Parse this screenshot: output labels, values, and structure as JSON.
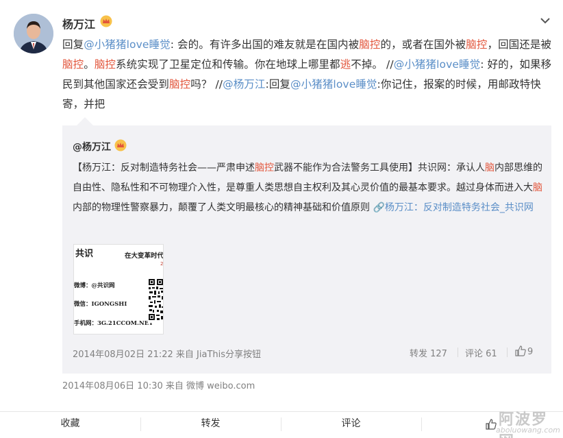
{
  "post": {
    "author": "杨万江",
    "segments": [
      {
        "t": "text",
        "v": "回复"
      },
      {
        "t": "mention",
        "v": "@小猪猪love睡觉"
      },
      {
        "t": "text",
        "v": ": 会的。有许多出国的难友就是在国内被"
      },
      {
        "t": "kw",
        "v": "脑控"
      },
      {
        "t": "text",
        "v": "的，或者在国外被"
      },
      {
        "t": "kw",
        "v": "脑控"
      },
      {
        "t": "text",
        "v": "，回国还是被"
      },
      {
        "t": "kw",
        "v": "脑控"
      },
      {
        "t": "text",
        "v": "。"
      },
      {
        "t": "kw",
        "v": "脑控"
      },
      {
        "t": "text",
        "v": "系统实现了卫星定位和传输。你在地球上哪里都"
      },
      {
        "t": "kw",
        "v": "逃"
      },
      {
        "t": "text",
        "v": "不掉。 //"
      },
      {
        "t": "mention",
        "v": "@小猪猪love睡觉"
      },
      {
        "t": "text",
        "v": ": 好的，如果移民到其他国家还会受到"
      },
      {
        "t": "kw",
        "v": "脑控"
      },
      {
        "t": "text",
        "v": "吗？ //"
      },
      {
        "t": "mention",
        "v": "@杨万江"
      },
      {
        "t": "text",
        "v": ":回复"
      },
      {
        "t": "mention",
        "v": "@小猪猪love睡觉"
      },
      {
        "t": "text",
        "v": ":你记住，报案的时候，用邮政特快寄，并把"
      }
    ],
    "meta": "2014年08月06日 10:30 来自 微博 weibo.com"
  },
  "quote": {
    "author": "@杨万江",
    "segments": [
      {
        "t": "text",
        "v": "【杨万江：反对制造特务社会——严肃申述"
      },
      {
        "t": "kw",
        "v": "脑控"
      },
      {
        "t": "text",
        "v": "武器不能作为合法警务工具使用】共识网：承认人"
      },
      {
        "t": "kw",
        "v": "脑"
      },
      {
        "t": "text",
        "v": "内部思维的自由性、隐私性和不可物理介入性，是尊重人类思想自主权利及其心灵价值的最基本要求。越过身体而进入大"
      },
      {
        "t": "kw",
        "v": "脑"
      },
      {
        "t": "text",
        "v": "内部的物理性警察暴力，颠覆了人类文明最核心的精神基础和价值原则 "
      },
      {
        "t": "link",
        "v": "🔗杨万江：反对制造特务社会_共识网"
      }
    ],
    "card": {
      "logo": "共识",
      "headline": "在大变革时代",
      "num": "21",
      "line1": "微博：@共识网",
      "line2": "微信：IGONGSHI",
      "line3": "手机网：3G.21CCOM.NET"
    },
    "meta": "2014年08月02日 21:22 来自 JiaThis分享按钮",
    "forward": "转发 127",
    "comment": "评论 61",
    "like": "9"
  },
  "bottom": {
    "favorite": "收藏",
    "forward": "转发",
    "comment": "评论",
    "like": ""
  },
  "watermark": {
    "cn": "阿波罗网",
    "en": "aboluowang.com"
  },
  "colors": {
    "mention": "#5a8ec7",
    "keyword": "#e2553b",
    "quote_bg": "#f2f2f5"
  }
}
